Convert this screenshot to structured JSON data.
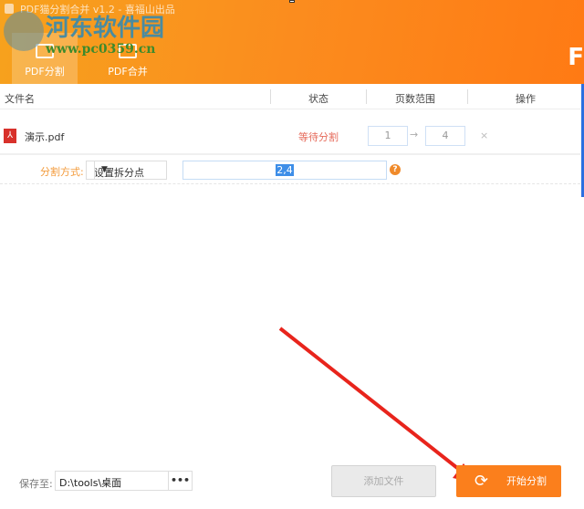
{
  "window": {
    "title": "PDF猫分割合并 v1.2 - 喜福山出品",
    "right_partial": "F"
  },
  "watermark": {
    "name": "河东软件园",
    "url": "www.pc0359.cn"
  },
  "tabs": [
    {
      "label": "PDF分割",
      "active": true
    },
    {
      "label": "PDF合并",
      "active": false
    }
  ],
  "table": {
    "headers": [
      "文件名",
      "状态",
      "页数范围",
      "操作"
    ],
    "rows": [
      {
        "file": "演示.pdf",
        "status": "等待分割",
        "from": "1",
        "arrow": "→",
        "to": "4",
        "action": "×"
      }
    ]
  },
  "split": {
    "label": "分割方式:",
    "method": "设置拆分点",
    "value": "2,4",
    "help": "?"
  },
  "footer": {
    "save_label": "保存至:",
    "save_path": "D:\\tools\\桌面",
    "browse": "•••",
    "add_file": "添加文件",
    "start": "开始分割"
  },
  "colors": {
    "accent": "#fb7f1c",
    "status": "#e66a5a"
  }
}
